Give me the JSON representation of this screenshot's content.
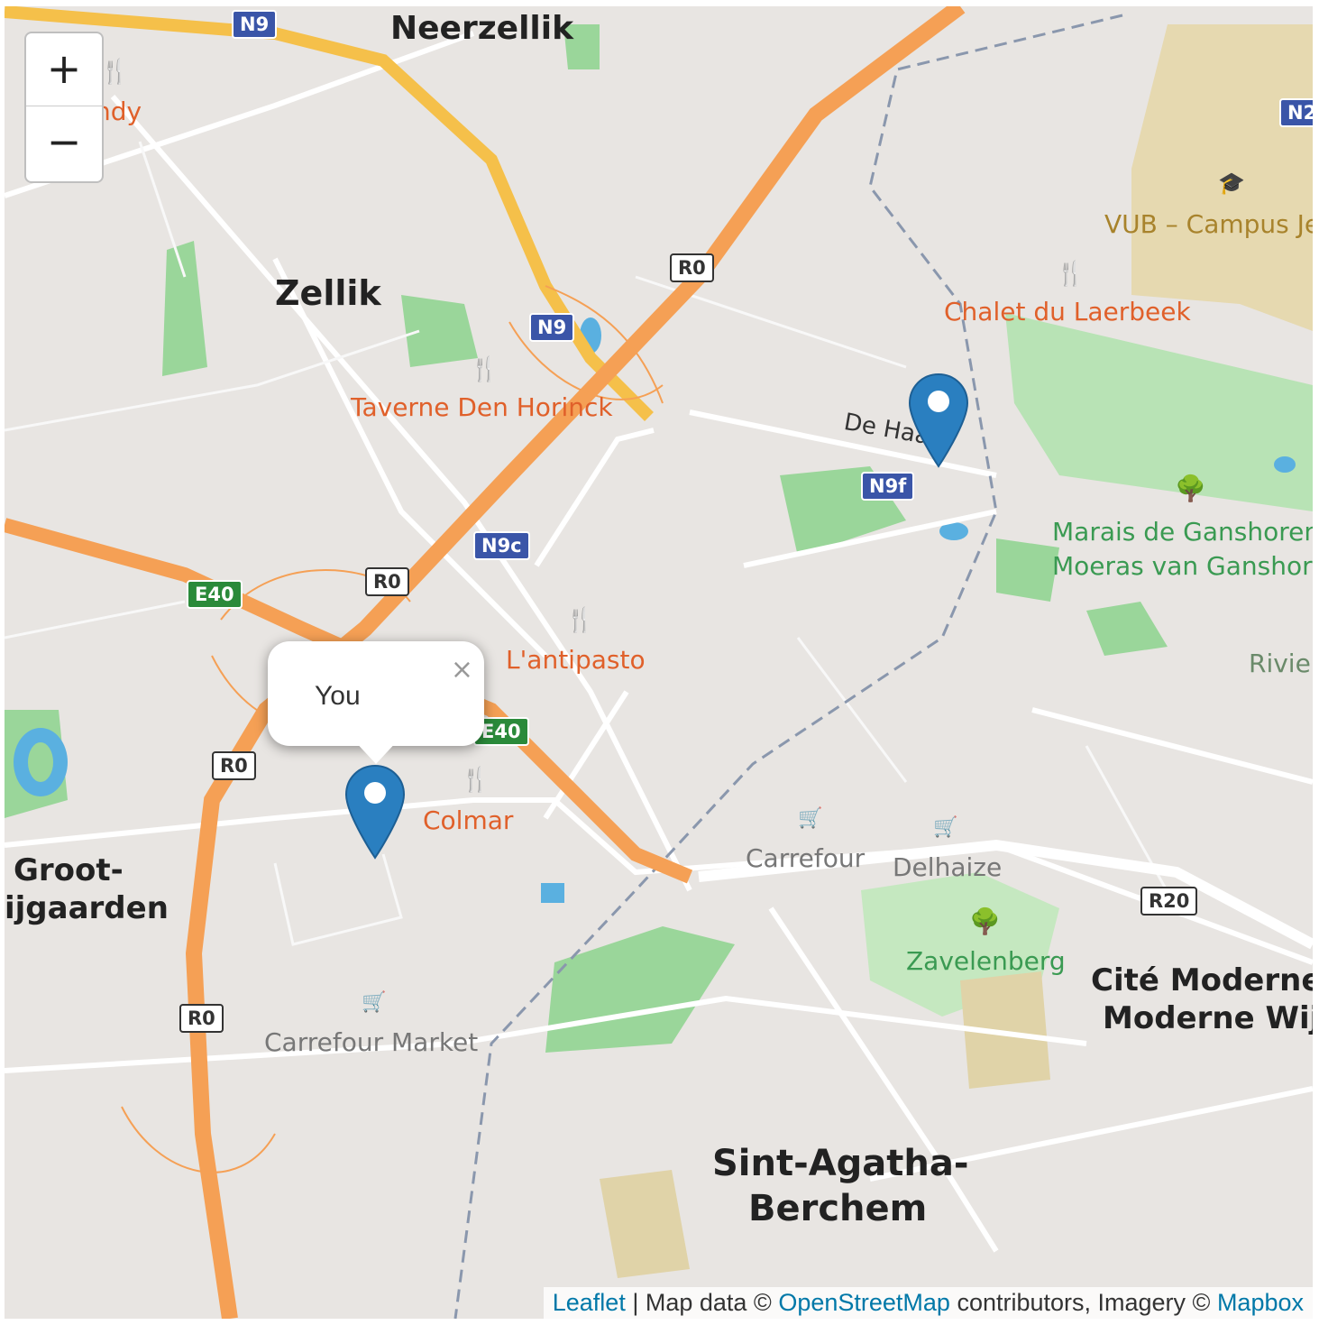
{
  "map": {
    "zoom_in_label": "+",
    "zoom_out_label": "−",
    "places": {
      "neerzellik": "Neerzellik",
      "zellik": "Zellik",
      "groot": "Groot-",
      "bijgaarden": "ijgaarden",
      "cite1": "Cité Moderne -",
      "cite2": "Moderne Wijk",
      "sint1": "Sint-Agatha-",
      "sint2": "Berchem"
    },
    "pois": {
      "andy": "ndy",
      "taverne": "Taverne Den Horinck",
      "chalet": "Chalet du Laerbeek",
      "antipasto": "L'antipasto",
      "colmar": "Colmar"
    },
    "shops": {
      "carrefour": "Carrefour",
      "delhaize": "Delhaize",
      "carrefour_market": "Carrefour Market"
    },
    "parks": {
      "marais1": "Marais de Ganshoren",
      "marais2": "Moeras van Ganshore",
      "zavelenberg": "Zavelenberg",
      "rivier": "Rivier"
    },
    "university": "VUB – Campus Je",
    "street": "De Haa",
    "shields": {
      "n9_top": "N9",
      "n9_mid": "N9",
      "n2": "N2",
      "n9f": "N9f",
      "n9c": "N9c",
      "e40_left": "E40",
      "e40_mid": "E40",
      "r0_top": "R0",
      "r0_mid": "R0",
      "r0_left": "R0",
      "r0_bottom": "R0",
      "r20": "R20"
    },
    "popup": {
      "text": "You",
      "close": "×"
    },
    "attribution": {
      "leaflet": "Leaflet",
      "sep": " | Map data © ",
      "osm": "OpenStreetMap",
      "middle": " contributors, Imagery © ",
      "mapbox": "Mapbox"
    },
    "colors": {
      "marker": "#2a7fc0",
      "motorway": "#f5a055",
      "primary": "#f5c04a",
      "park": "#8fd18f",
      "water": "#5ab0e0"
    }
  }
}
